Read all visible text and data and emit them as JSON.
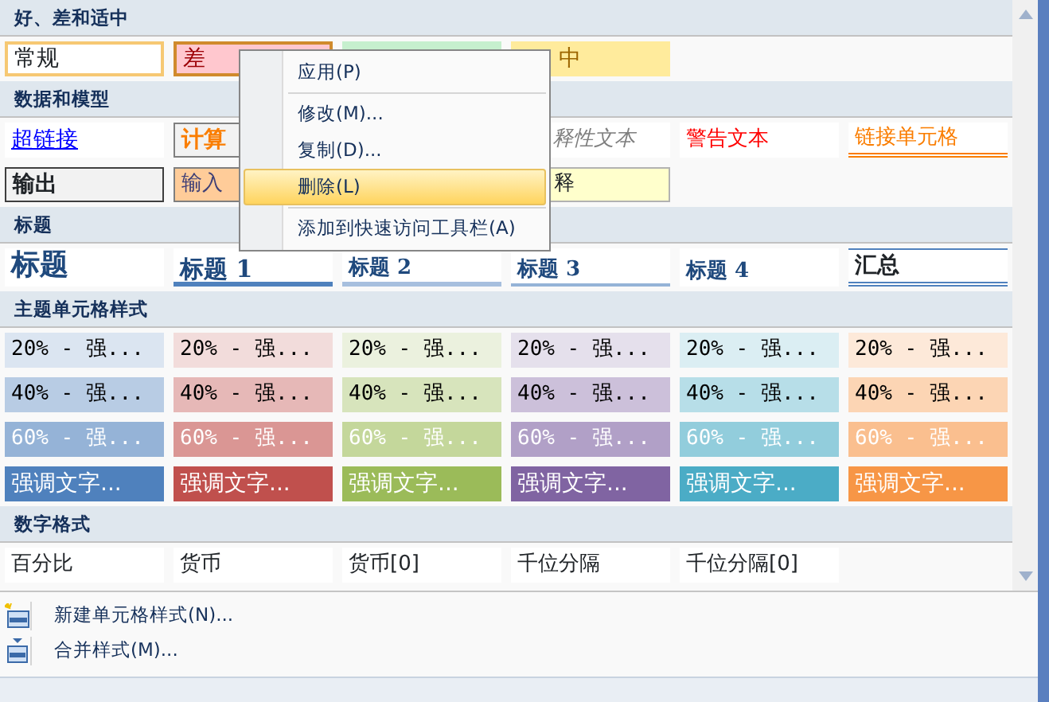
{
  "sections": [
    {
      "title": "好、差和适中",
      "rows": [
        [
          {
            "kind": "normal",
            "text": "常规",
            "selected": false
          },
          {
            "kind": "bad",
            "text": "差",
            "selected": true
          },
          {
            "kind": "good",
            "selected": false
          },
          {
            "kind": "neutral",
            "text": "中",
            "selected": false
          }
        ]
      ]
    },
    {
      "title": "数据和模型",
      "rows": [
        [
          {
            "kind": "hyperlink",
            "text": "超链接",
            "selected": false
          },
          {
            "kind": "calc",
            "text": "计算",
            "selected": false
          },
          {
            "kind": "blank"
          },
          {
            "kind": "explain",
            "text": "释性文本",
            "selected": false
          },
          {
            "kind": "warn",
            "text": "警告文本",
            "selected": false
          },
          {
            "kind": "linked",
            "text": "链接单元格",
            "selected": false
          }
        ],
        [
          {
            "kind": "output",
            "text": "输出",
            "selected": false
          },
          {
            "kind": "input",
            "text": "输入",
            "selected": false
          },
          {
            "kind": "blank"
          },
          {
            "kind": "note",
            "text": "释",
            "selected": false
          }
        ]
      ]
    },
    {
      "title": "标题",
      "rows": [
        [
          {
            "kind": "title",
            "text": "标题",
            "selected": false
          },
          {
            "kind": "h1",
            "text": "标题 1",
            "selected": false
          },
          {
            "kind": "h2",
            "text": "标题 2",
            "selected": false
          },
          {
            "kind": "h3",
            "text": "标题 3",
            "selected": false
          },
          {
            "kind": "h4",
            "text": "标题 4",
            "selected": false
          },
          {
            "kind": "total",
            "text": "汇总",
            "selected": false
          }
        ]
      ]
    },
    {
      "title": "主题单元格样式",
      "rows": [
        [
          {
            "kind": "theme",
            "color": "#dbe5f1",
            "text": "20% - 强...",
            "selected": false
          },
          {
            "kind": "theme",
            "color": "#f2dcdb",
            "text": "20% - 强...",
            "selected": false
          },
          {
            "kind": "theme",
            "color": "#ebf1de",
            "text": "20% - 强...",
            "selected": false
          },
          {
            "kind": "theme",
            "color": "#e5e0ec",
            "text": "20% - 强...",
            "selected": false
          },
          {
            "kind": "theme",
            "color": "#dbeef3",
            "text": "20% - 强...",
            "selected": false
          },
          {
            "kind": "theme",
            "color": "#fde9d9",
            "text": "20% - 强...",
            "selected": false
          }
        ],
        [
          {
            "kind": "theme",
            "color": "#b8cce4",
            "text": "40% - 强...",
            "selected": false
          },
          {
            "kind": "theme",
            "color": "#e6b8b7",
            "text": "40% - 强...",
            "selected": false
          },
          {
            "kind": "theme",
            "color": "#d7e4bc",
            "text": "40% - 强...",
            "selected": false
          },
          {
            "kind": "theme",
            "color": "#ccc0da",
            "text": "40% - 强...",
            "selected": false
          },
          {
            "kind": "theme",
            "color": "#b7dee8",
            "text": "40% - 强...",
            "selected": false
          },
          {
            "kind": "theme",
            "color": "#fcd5b4",
            "text": "40% - 强...",
            "selected": false
          }
        ],
        [
          {
            "kind": "theme-light",
            "color": "#95b3d7",
            "text": "60% - 强...",
            "selected": false
          },
          {
            "kind": "theme-light",
            "color": "#da9694",
            "text": "60% - 强...",
            "selected": false
          },
          {
            "kind": "theme-light",
            "color": "#c4d79b",
            "text": "60% - 强...",
            "selected": false
          },
          {
            "kind": "theme-light",
            "color": "#b1a0c7",
            "text": "60% - 强...",
            "selected": false
          },
          {
            "kind": "theme-light",
            "color": "#92cddc",
            "text": "60% - 强...",
            "selected": false
          },
          {
            "kind": "theme-light",
            "color": "#fabf8f",
            "text": "60% - 强...",
            "selected": false
          }
        ],
        [
          {
            "kind": "accent",
            "color": "#4f81bd",
            "text": "强调文字...",
            "selected": false
          },
          {
            "kind": "accent",
            "color": "#c0504d",
            "text": "强调文字...",
            "selected": false
          },
          {
            "kind": "accent",
            "color": "#9bbb59",
            "text": "强调文字...",
            "selected": false
          },
          {
            "kind": "accent",
            "color": "#8064a2",
            "text": "强调文字...",
            "selected": false
          },
          {
            "kind": "accent",
            "color": "#4bacc6",
            "text": "强调文字...",
            "selected": false
          },
          {
            "kind": "accent",
            "color": "#f79646",
            "text": "强调文字...",
            "selected": false
          }
        ]
      ]
    },
    {
      "title": "数字格式",
      "rows": [
        [
          {
            "kind": "plain",
            "text": "百分比",
            "selected": false
          },
          {
            "kind": "plain",
            "text": "货币",
            "selected": false
          },
          {
            "kind": "plain",
            "text": "货币[0]",
            "selected": false
          },
          {
            "kind": "plain",
            "text": "千位分隔",
            "selected": false
          },
          {
            "kind": "plain",
            "text": "千位分隔[0]",
            "selected": false
          }
        ]
      ]
    }
  ],
  "footer_menu": [
    {
      "label": "新建单元格样式(N)..."
    },
    {
      "label": "合并样式(M)..."
    }
  ],
  "context_menu": [
    {
      "label": "应用(P)",
      "selected": false,
      "separator_after": true
    },
    {
      "label": "修改(M)...",
      "selected": false,
      "separator_after": false
    },
    {
      "label": "复制(D)...",
      "selected": false,
      "separator_after": false
    },
    {
      "label": "删除(L)",
      "selected": true,
      "separator_after": true
    },
    {
      "label": "添加到快速访问工具栏(A)",
      "selected": false,
      "separator_after": false
    }
  ]
}
